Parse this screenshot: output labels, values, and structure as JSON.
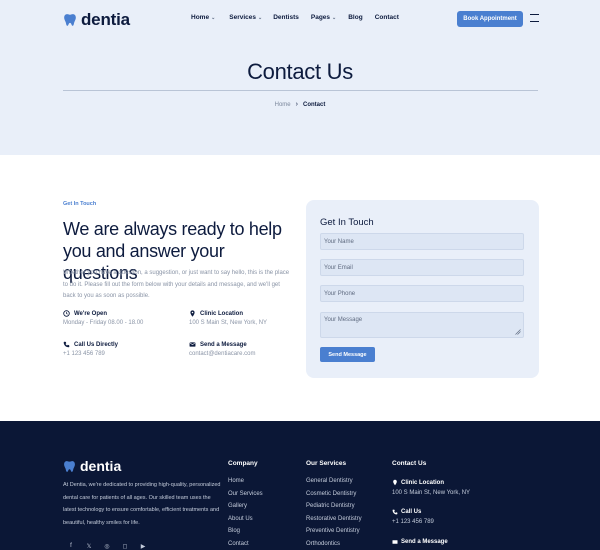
{
  "brand": {
    "name": "dentia",
    "accent": "#4a7fd0",
    "dark": "#0b1736"
  },
  "nav": {
    "items": [
      {
        "label": "Home",
        "dropdown": true
      },
      {
        "label": "Services",
        "dropdown": true
      },
      {
        "label": "Dentists",
        "dropdown": false
      },
      {
        "label": "Pages",
        "dropdown": true
      },
      {
        "label": "Blog",
        "dropdown": false
      },
      {
        "label": "Contact",
        "dropdown": false
      }
    ],
    "book_label": "Book Appointment"
  },
  "hero": {
    "title": "Contact Us",
    "breadcrumb": {
      "home": "Home",
      "current": "Contact"
    }
  },
  "contact": {
    "eyebrow": "Get In Touch",
    "headline": "We are always ready to help you and answer your questions",
    "intro": "Whether you have a question, a suggestion, or just want to say hello, this is the place to do it. Please fill out the form below with your details and message, and we'll get back to you as soon as possible.",
    "open": {
      "title": "We're Open",
      "value": "Monday - Friday 08.00 - 18.00"
    },
    "location": {
      "title": "Clinic Location",
      "value": "100 S Main St, New York, NY"
    },
    "call": {
      "title": "Call Us Directly",
      "value": "+1 123 456 789"
    },
    "message": {
      "title": "Send a Message",
      "value": "contact@dentiacare.com"
    }
  },
  "form": {
    "title": "Get In Touch",
    "name_placeholder": "Your Name",
    "email_placeholder": "Your Email",
    "phone_placeholder": "Your Phone",
    "message_placeholder": "Your Message",
    "submit_label": "Send Message"
  },
  "footer": {
    "brand": "dentia",
    "about": "At Dentia, we're dedicated to providing high-quality, personalized dental care for patients of all ages. Our skilled team uses the latest technology to ensure comfortable, efficient treatments and beautiful, healthy smiles for life.",
    "socials": [
      "facebook-icon",
      "x-icon",
      "whatsapp-icon",
      "instagram-icon",
      "youtube-icon"
    ],
    "company": {
      "title": "Company",
      "links": [
        "Home",
        "Our Services",
        "Gallery",
        "About Us",
        "Blog",
        "Contact"
      ]
    },
    "services": {
      "title": "Our Services",
      "links": [
        "General Dentistry",
        "Cosmetic Dentistry",
        "Pediatric Dentistry",
        "Restorative Dentistry",
        "Preventive Dentistry",
        "Orthodontics"
      ]
    },
    "contact": {
      "title": "Contact Us",
      "location": {
        "title": "Clinic Location",
        "value": "100 S Main St, New York, NY"
      },
      "call": {
        "title": "Call Us",
        "value": "+1 123 456 789"
      },
      "message": {
        "title": "Send a Message"
      }
    }
  }
}
